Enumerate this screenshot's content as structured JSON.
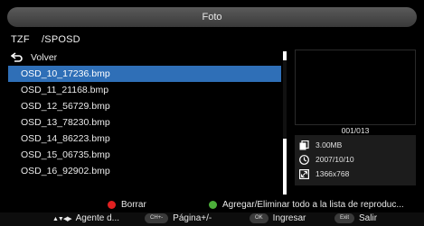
{
  "header": {
    "title": "Foto"
  },
  "path": {
    "source": "TZF",
    "folder": "/SPOSD"
  },
  "file_list": {
    "back_label": "Volver",
    "items": [
      {
        "name": "OSD_10_17236.bmp",
        "selected": true
      },
      {
        "name": "OSD_11_21168.bmp",
        "selected": false
      },
      {
        "name": "OSD_12_56729.bmp",
        "selected": false
      },
      {
        "name": "OSD_13_78230.bmp",
        "selected": false
      },
      {
        "name": "OSD_14_86223.bmp",
        "selected": false
      },
      {
        "name": "OSD_15_06735.bmp",
        "selected": false
      },
      {
        "name": "OSD_16_92902.bmp",
        "selected": false
      }
    ]
  },
  "preview": {
    "counter": "001/013",
    "size": "3.00MB",
    "date": "2007/10/10",
    "resolution": "1366x768"
  },
  "legend": {
    "red_label": "Borrar",
    "green_label": "Agregar/Eliminar todo a la lista de reproduc..."
  },
  "hints": {
    "agent_label": "Agente d...",
    "ch_key": "CH+-",
    "page_label": "Página+/-",
    "ok_key": "OK",
    "ok_label": "Ingresar",
    "exit_key": "Exit",
    "exit_label": "Salir"
  },
  "colors": {
    "selection": "#2f6fb7",
    "red_button": "#e02020",
    "green_button": "#4caf3a"
  }
}
